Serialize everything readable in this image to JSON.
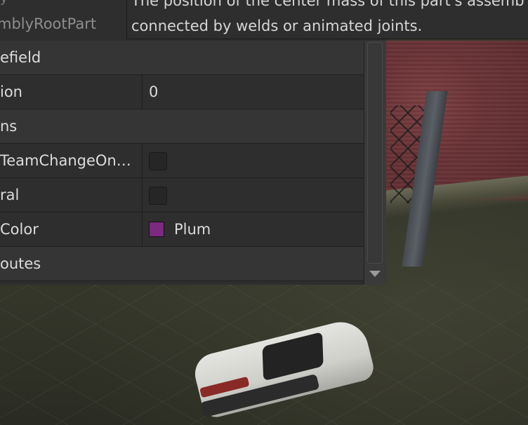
{
  "tooltip": {
    "line1": "The position of the center mass of this part's assemb",
    "line2": "connected by welds or animated joints."
  },
  "panel_top": {
    "prev_label": "y",
    "prop_name": "mblyRootPart"
  },
  "rows": [
    {
      "type": "category",
      "label": "efield"
    },
    {
      "type": "prop",
      "label": "ion",
      "value": "0"
    },
    {
      "type": "category",
      "label": "ns"
    },
    {
      "type": "prop",
      "label": "TeamChangeOn…",
      "value_kind": "checkbox",
      "checked": false
    },
    {
      "type": "prop",
      "label": "ral",
      "value_kind": "checkbox",
      "checked": false
    },
    {
      "type": "prop",
      "label": "Color",
      "value_kind": "color",
      "color": "#7b2a80",
      "value": "Plum"
    },
    {
      "type": "category",
      "label": "outes"
    }
  ],
  "colors": {
    "panel_bg": "#2e2e2e",
    "category_bg": "#353535",
    "text": "#dcdcdc",
    "plum": "#7b2a80"
  },
  "icons": {
    "scroll_down": "triangle-down"
  }
}
